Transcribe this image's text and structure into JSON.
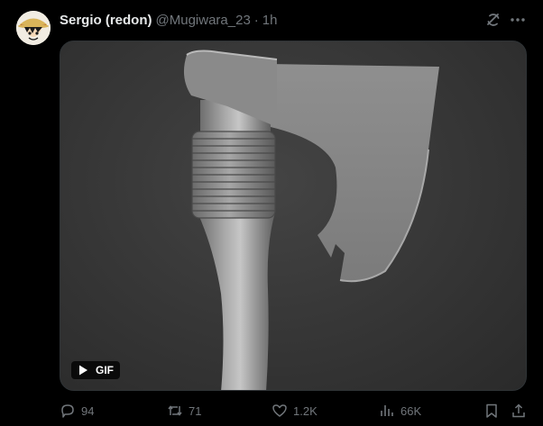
{
  "author": {
    "name": "Sergio (redon)",
    "handle": "@Mugiwara_23",
    "separator": "·",
    "time": "1h"
  },
  "media": {
    "badge_label": "GIF"
  },
  "actions": {
    "replies": "94",
    "reposts": "71",
    "likes": "1.2K",
    "views": "66K"
  },
  "colors": {
    "background": "#000000",
    "text_primary": "#e7e9ea",
    "text_secondary": "#71767b",
    "media_border": "#2f3336"
  },
  "icons": [
    "avatar",
    "grok-icon",
    "more-icon",
    "play-icon",
    "reply-icon",
    "repost-icon",
    "like-icon",
    "views-icon",
    "bookmark-icon",
    "share-icon"
  ]
}
